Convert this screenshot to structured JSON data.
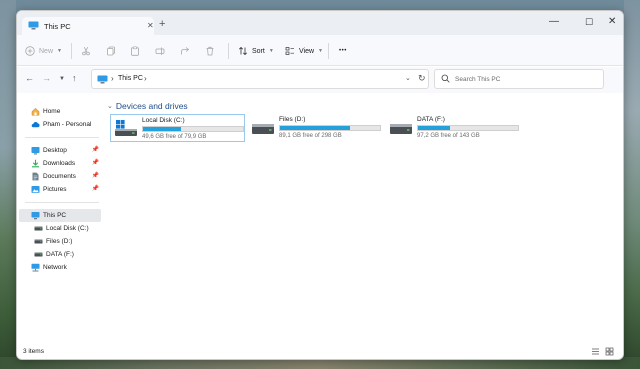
{
  "window": {
    "tab_title": "This PC",
    "tab_close": "✕",
    "new_tab": "+",
    "controls": {
      "minimize": "—",
      "maximize": "☐",
      "close": "✕"
    }
  },
  "toolbar": {
    "new_label": "New",
    "sort_label": "Sort",
    "view_label": "View",
    "more_label": "•••"
  },
  "address_bar": {
    "path_label": "This PC",
    "search_placeholder": "Search This PC"
  },
  "sidebar": {
    "quick": [
      {
        "label": "Home",
        "icon": "home-icon"
      },
      {
        "label": "Pham - Personal",
        "icon": "cloud-icon"
      }
    ],
    "pinned": [
      {
        "label": "Desktop",
        "icon": "desktop-folder-icon",
        "color": "#2f9ae6"
      },
      {
        "label": "Downloads",
        "icon": "downloads-folder-icon",
        "color": "#2dab56"
      },
      {
        "label": "Documents",
        "icon": "documents-folder-icon",
        "color": "#6e7f8e"
      },
      {
        "label": "Pictures",
        "icon": "pictures-folder-icon",
        "color": "#2f9ae6"
      }
    ],
    "this_pc": {
      "label": "This PC",
      "icon": "this-pc-icon"
    },
    "drives": [
      {
        "label": "Local Disk (C:)",
        "icon": "drive-icon"
      },
      {
        "label": "Files (D:)",
        "icon": "drive-icon"
      },
      {
        "label": "DATA (F:)",
        "icon": "drive-icon"
      }
    ],
    "network": {
      "label": "Network",
      "icon": "network-icon"
    }
  },
  "main": {
    "group_title": "Devices and drives",
    "drives": [
      {
        "name": "Local Disk (C:)",
        "free_text": "49,6 GB free of 79,9 GB",
        "used_fraction": 0.38,
        "icon": "windows-drive-icon"
      },
      {
        "name": "Files (D:)",
        "free_text": "89,1 GB free of 298 GB",
        "used_fraction": 0.7,
        "icon": "hard-drive-icon"
      },
      {
        "name": "DATA (F:)",
        "free_text": "97,2 GB free of 143 GB",
        "used_fraction": 0.32,
        "icon": "hard-drive-icon"
      }
    ]
  },
  "status_bar": {
    "item_count": "3 items"
  },
  "colors": {
    "accent": "#26a0da",
    "folder_blue": "#2f9ae6",
    "selection_border": "#99c9ef",
    "group_header": "#1f4e8c"
  }
}
